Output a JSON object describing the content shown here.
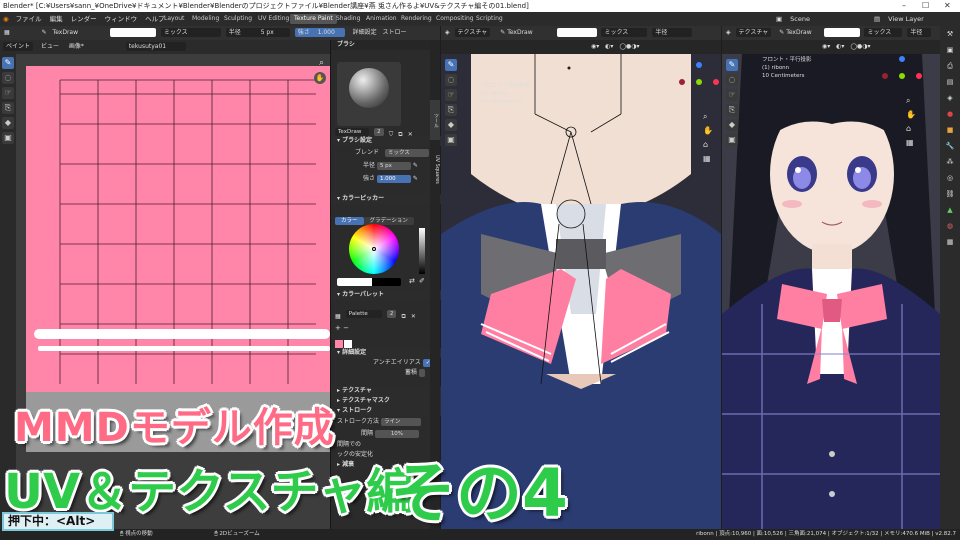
{
  "window": {
    "title": "Blender* [C:¥Users¥sann_¥OneDrive¥ドキュメント¥Blender¥Blenderのプロジェクトファイル¥Blender講座¥燕 兎さん作るよ¥UV&テクスチャ編その01.blend]"
  },
  "menu": {
    "items": [
      "ファイル",
      "編集",
      "レンダー",
      "ウィンドウ",
      "ヘルプ"
    ]
  },
  "workspaces": [
    "Layout",
    "Modeling",
    "Sculpting",
    "UV Editing",
    "Texture Paint",
    "Shading",
    "Animation",
    "Rendering",
    "Compositing",
    "Scripting"
  ],
  "scene": {
    "label": "Scene",
    "view_layer": "View Layer"
  },
  "image_editor": {
    "brush": "TexDraw",
    "blend": "ミックス",
    "radius_label": "半径",
    "radius": "5 px",
    "strength_label": "強さ",
    "strength": "1.000",
    "extra1": "詳細設定",
    "extra2": "ストロー",
    "mode": "ペイント",
    "view": "ビュー",
    "image": "画像*",
    "image_name": "tekusutya01"
  },
  "properties": {
    "brush_name": "TexDraw",
    "brush_users": "2",
    "section_brush": "ブラシ設定",
    "blend_label": "ブレンド",
    "blend_value": "ミックス",
    "radius_label": "半径",
    "radius_value": "5 px",
    "strength_label": "強さ",
    "strength_value": "1.000",
    "section_picker": "カラーピッカー",
    "tab_color": "カラー",
    "tab_gradient": "グラデーション",
    "section_palette": "カラーパレット",
    "palette_name": "Palette",
    "palette_users": "2",
    "section_advanced": "詳細設定",
    "antialias": "アンチエイリアス",
    "accumulate": "蓄積",
    "section_texture": "テクスチャ",
    "section_texmask": "テクスチャマスク",
    "section_stroke": "ストローク",
    "stroke_method_label": "ストローク方法",
    "stroke_method": "ライン",
    "spacing_label": "間隔",
    "spacing_value": "10%",
    "fragment1": "間隔での",
    "fragment2": "ックの安定化",
    "section_falloff": "減衰",
    "side_tab": "UV Squares"
  },
  "viewport_mid": {
    "mode": "テクスチャ",
    "brush": "TexDraw",
    "blend": "ミックス",
    "radius": "半径",
    "view_text": "フロント・平行投影",
    "object": "(1) ribonn",
    "units": "10 Centimeters"
  },
  "viewport_right": {
    "mode": "テクスチャ",
    "brush": "TexDraw",
    "blend": "ミックス",
    "radius": "半径",
    "view_text": "フロント・平行投影",
    "object": "(1) ribonn",
    "units": "10 Centimeters"
  },
  "statusbar": {
    "left1": "視点の移動",
    "left2": "2Dビューズーム",
    "stats": "ribonn | 頂点:10,960 | 面:10,526 | 三角面:21,074 | オブジェクト:1/32 | メモリ:470.6 MiB | v2.82.7"
  },
  "overlay": {
    "line1": "MMDモデル作成",
    "line2": "UV＆テクスチャ編",
    "line3": "その4",
    "key": "押下中：<Alt>"
  },
  "colors": {
    "pink": "#ff86a8",
    "accent": "#4772b3"
  }
}
